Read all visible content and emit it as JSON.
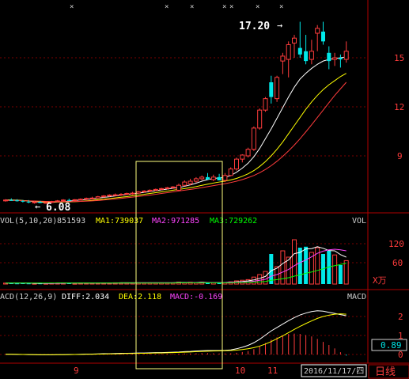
{
  "price_panel": {
    "y_ticks": [
      "15",
      "12",
      "9"
    ],
    "high_label": "17.20",
    "high_arrow": "→",
    "low_label": "6.08",
    "low_arrow": "←"
  },
  "volume_panel": {
    "title": "VOL(5,10,20)",
    "vol_value": "851593",
    "ma1_label": "MA1:739037",
    "ma2_label": "MA2:971285",
    "ma3_label": "MA3:729262",
    "right_label": "VOL",
    "y_ticks": [
      "120",
      "60"
    ],
    "unit_label": "X万"
  },
  "macd_panel": {
    "title": "MACD(12,26,9)",
    "diff_label": "DIFF:2.034",
    "dea_label": "DEA:2.118",
    "macd_label": "MACD:-0.169",
    "right_label": "MACD",
    "y_ticks": [
      "2",
      "1",
      "0"
    ],
    "value_box": "0.89"
  },
  "x_axis": {
    "labels": [
      "9",
      "10",
      "11"
    ],
    "date_box": "2016/11/17/四",
    "period_button": "日线"
  },
  "colors": {
    "up": "#ff3c3c",
    "down": "#00e8e8",
    "ma1": "#ffffff",
    "ma2": "#ffff00",
    "ma3": "#ff44ff",
    "ma4": "#00ff00",
    "grid": "#7a0000",
    "highlight_box": "#ffff80",
    "axis_text": "#ff3c3c"
  },
  "chart_data": [
    {
      "type": "candlestick",
      "title": "",
      "y_ticks": [
        9,
        12,
        15
      ],
      "ylim": [
        5,
        18
      ],
      "candles": [
        {
          "o": 6.25,
          "h": 6.35,
          "l": 6.2,
          "c": 6.3
        },
        {
          "o": 6.3,
          "h": 6.4,
          "l": 6.25,
          "c": 6.28
        },
        {
          "o": 6.28,
          "h": 6.35,
          "l": 6.2,
          "c": 6.25
        },
        {
          "o": 6.25,
          "h": 6.3,
          "l": 6.15,
          "c": 6.2
        },
        {
          "o": 6.2,
          "h": 6.3,
          "l": 6.1,
          "c": 6.15
        },
        {
          "o": 6.15,
          "h": 6.25,
          "l": 6.08,
          "c": 6.18
        },
        {
          "o": 6.18,
          "h": 6.25,
          "l": 6.1,
          "c": 6.12
        },
        {
          "o": 6.12,
          "h": 6.2,
          "l": 6.08,
          "c": 6.15
        },
        {
          "o": 6.15,
          "h": 6.25,
          "l": 6.1,
          "c": 6.2
        },
        {
          "o": 6.2,
          "h": 6.3,
          "l": 6.15,
          "c": 6.25
        },
        {
          "o": 6.25,
          "h": 6.35,
          "l": 6.2,
          "c": 6.3
        },
        {
          "o": 6.3,
          "h": 6.38,
          "l": 6.25,
          "c": 6.28
        },
        {
          "o": 6.28,
          "h": 6.35,
          "l": 6.2,
          "c": 6.32
        },
        {
          "o": 6.32,
          "h": 6.4,
          "l": 6.28,
          "c": 6.35
        },
        {
          "o": 6.35,
          "h": 6.45,
          "l": 6.3,
          "c": 6.4
        },
        {
          "o": 6.4,
          "h": 6.5,
          "l": 6.35,
          "c": 6.42
        },
        {
          "o": 6.42,
          "h": 6.55,
          "l": 6.38,
          "c": 6.5
        },
        {
          "o": 6.5,
          "h": 6.6,
          "l": 6.45,
          "c": 6.55
        },
        {
          "o": 6.55,
          "h": 6.65,
          "l": 6.5,
          "c": 6.6
        },
        {
          "o": 6.6,
          "h": 6.7,
          "l": 6.55,
          "c": 6.62
        },
        {
          "o": 6.62,
          "h": 6.72,
          "l": 6.55,
          "c": 6.65
        },
        {
          "o": 6.65,
          "h": 6.75,
          "l": 6.6,
          "c": 6.7
        },
        {
          "o": 6.7,
          "h": 6.8,
          "l": 6.62,
          "c": 6.72
        },
        {
          "o": 6.72,
          "h": 6.85,
          "l": 6.68,
          "c": 6.8
        },
        {
          "o": 6.8,
          "h": 6.9,
          "l": 6.75,
          "c": 6.85
        },
        {
          "o": 6.85,
          "h": 6.95,
          "l": 6.8,
          "c": 6.9
        },
        {
          "o": 6.9,
          "h": 7.0,
          "l": 6.85,
          "c": 6.95
        },
        {
          "o": 6.95,
          "h": 7.05,
          "l": 6.9,
          "c": 7.0
        },
        {
          "o": 7.0,
          "h": 7.1,
          "l": 6.95,
          "c": 7.05
        },
        {
          "o": 7.05,
          "h": 7.15,
          "l": 7.0,
          "c": 7.1
        },
        {
          "o": 6.9,
          "h": 7.3,
          "l": 6.85,
          "c": 7.2
        },
        {
          "o": 7.2,
          "h": 7.5,
          "l": 7.15,
          "c": 7.4
        },
        {
          "o": 7.3,
          "h": 7.6,
          "l": 7.2,
          "c": 7.45
        },
        {
          "o": 7.45,
          "h": 7.7,
          "l": 7.35,
          "c": 7.6
        },
        {
          "o": 7.6,
          "h": 7.8,
          "l": 7.5,
          "c": 7.7
        },
        {
          "o": 7.7,
          "h": 7.95,
          "l": 7.6,
          "c": 7.55
        },
        {
          "o": 7.55,
          "h": 7.85,
          "l": 7.45,
          "c": 7.7
        },
        {
          "o": 7.7,
          "h": 7.9,
          "l": 7.6,
          "c": 7.5
        },
        {
          "o": 7.5,
          "h": 7.95,
          "l": 7.4,
          "c": 7.8
        },
        {
          "o": 7.8,
          "h": 8.3,
          "l": 7.75,
          "c": 8.2
        },
        {
          "o": 8.2,
          "h": 8.9,
          "l": 8.1,
          "c": 8.8
        },
        {
          "o": 8.8,
          "h": 9.1,
          "l": 8.6,
          "c": 9.05
        },
        {
          "o": 9.0,
          "h": 9.5,
          "l": 8.9,
          "c": 9.4
        },
        {
          "o": 9.4,
          "h": 10.8,
          "l": 9.3,
          "c": 10.7
        },
        {
          "o": 10.7,
          "h": 11.9,
          "l": 10.6,
          "c": 11.8
        },
        {
          "o": 11.8,
          "h": 12.6,
          "l": 11.7,
          "c": 12.5
        },
        {
          "o": 13.5,
          "h": 13.9,
          "l": 12.2,
          "c": 12.6
        },
        {
          "o": 12.5,
          "h": 13.9,
          "l": 12.3,
          "c": 13.8
        },
        {
          "o": 14.8,
          "h": 15.3,
          "l": 14.0,
          "c": 15.1
        },
        {
          "o": 14.9,
          "h": 16.0,
          "l": 13.8,
          "c": 15.8
        },
        {
          "o": 15.9,
          "h": 16.4,
          "l": 15.0,
          "c": 16.2
        },
        {
          "o": 15.6,
          "h": 17.2,
          "l": 15.0,
          "c": 15.2
        },
        {
          "o": 15.4,
          "h": 16.4,
          "l": 14.6,
          "c": 14.8
        },
        {
          "o": 14.9,
          "h": 16.1,
          "l": 14.6,
          "c": 15.4
        },
        {
          "o": 16.5,
          "h": 17.0,
          "l": 15.4,
          "c": 16.8
        },
        {
          "o": 16.6,
          "h": 17.2,
          "l": 15.8,
          "c": 16.0
        },
        {
          "o": 15.3,
          "h": 15.7,
          "l": 14.3,
          "c": 14.8
        },
        {
          "o": 14.9,
          "h": 15.3,
          "l": 14.5,
          "c": 15.0
        },
        {
          "o": 15.0,
          "h": 15.2,
          "l": 14.4,
          "c": 14.9
        },
        {
          "o": 14.9,
          "h": 16.0,
          "l": 14.7,
          "c": 15.4
        }
      ],
      "ma_lines": [
        {
          "name": "MA1",
          "values": [
            6.3,
            6.3,
            6.29,
            6.27,
            6.24,
            6.2,
            6.18,
            6.16,
            6.16,
            6.18,
            6.2,
            6.23,
            6.27,
            6.3,
            6.33,
            6.37,
            6.42,
            6.46,
            6.5,
            6.55,
            6.6,
            6.64,
            6.68,
            6.72,
            6.77,
            6.82,
            6.87,
            6.92,
            6.97,
            7.02,
            7.06,
            7.14,
            7.23,
            7.33,
            7.45,
            7.55,
            7.62,
            7.65,
            7.68,
            7.8,
            8.0,
            8.25,
            8.55,
            8.95,
            9.45,
            10.05,
            10.65,
            11.3,
            11.95,
            12.6,
            13.2,
            13.7,
            14.05,
            14.35,
            14.6,
            14.8,
            14.9,
            14.95,
            15.0,
            15.05
          ]
        },
        {
          "name": "MA2",
          "values": [
            6.29,
            6.29,
            6.28,
            6.27,
            6.25,
            6.23,
            6.21,
            6.19,
            6.18,
            6.18,
            6.18,
            6.19,
            6.2,
            6.22,
            6.25,
            6.28,
            6.32,
            6.35,
            6.39,
            6.43,
            6.47,
            6.51,
            6.56,
            6.6,
            6.65,
            6.7,
            6.75,
            6.8,
            6.85,
            6.9,
            6.95,
            7.0,
            7.06,
            7.12,
            7.2,
            7.27,
            7.34,
            7.4,
            7.46,
            7.53,
            7.62,
            7.75,
            7.9,
            8.1,
            8.35,
            8.65,
            9.0,
            9.4,
            9.85,
            10.35,
            10.85,
            11.35,
            11.85,
            12.3,
            12.7,
            13.05,
            13.35,
            13.6,
            13.85,
            14.05
          ]
        },
        {
          "name": "MA3",
          "values": [
            6.27,
            6.27,
            6.27,
            6.26,
            6.25,
            6.24,
            6.23,
            6.22,
            6.21,
            6.2,
            6.2,
            6.2,
            6.21,
            6.22,
            6.23,
            6.25,
            6.27,
            6.3,
            6.33,
            6.36,
            6.4,
            6.44,
            6.48,
            6.52,
            6.56,
            6.6,
            6.65,
            6.7,
            6.75,
            6.8,
            6.85,
            6.9,
            6.95,
            7.0,
            7.06,
            7.12,
            7.18,
            7.24,
            7.3,
            7.37,
            7.45,
            7.55,
            7.67,
            7.8,
            7.97,
            8.17,
            8.4,
            8.67,
            8.97,
            9.3,
            9.66,
            10.05,
            10.47,
            10.9,
            11.35,
            11.8,
            12.25,
            12.7,
            13.1,
            13.5
          ]
        }
      ]
    },
    {
      "type": "bar",
      "title": "VOL(5,10,20)",
      "y_ticks": [
        60,
        120
      ],
      "ylim": [
        0,
        170
      ],
      "values": [
        3,
        3,
        2,
        3,
        2,
        2,
        2,
        2,
        3,
        3,
        3,
        3,
        2,
        3,
        3,
        3,
        3,
        3,
        3,
        4,
        4,
        4,
        4,
        4,
        4,
        4,
        4,
        4,
        4,
        4,
        6,
        5,
        6,
        5,
        6,
        5,
        5,
        6,
        5,
        7,
        10,
        12,
        14,
        22,
        30,
        40,
        95,
        55,
        105,
        85,
        140,
        115,
        118,
        100,
        115,
        95,
        105,
        92,
        60,
        74
      ],
      "up": [
        1,
        0,
        0,
        0,
        0,
        1,
        0,
        1,
        1,
        1,
        1,
        0,
        1,
        1,
        1,
        1,
        1,
        1,
        1,
        1,
        1,
        1,
        1,
        1,
        1,
        1,
        1,
        1,
        1,
        1,
        1,
        1,
        1,
        1,
        1,
        0,
        1,
        0,
        1,
        1,
        1,
        1,
        1,
        1,
        1,
        1,
        0,
        1,
        1,
        1,
        1,
        0,
        0,
        1,
        1,
        0,
        0,
        1,
        0,
        1
      ],
      "ma_lines": [
        {
          "name": "MA1",
          "values": [
            3,
            3,
            3,
            3,
            3,
            2,
            2,
            2,
            2,
            3,
            3,
            3,
            3,
            3,
            3,
            3,
            3,
            3,
            3,
            3,
            4,
            4,
            4,
            4,
            4,
            4,
            4,
            4,
            4,
            4,
            5,
            5,
            5,
            5,
            6,
            5,
            5,
            5,
            5,
            6,
            7,
            8,
            10,
            13,
            18,
            24,
            42,
            50,
            65,
            76,
            96,
            100,
            111,
            112,
            118,
            113,
            106,
            105,
            93,
            85
          ]
        },
        {
          "name": "MA2",
          "values": [
            3,
            3,
            3,
            3,
            3,
            3,
            3,
            2,
            2,
            2,
            2,
            3,
            3,
            3,
            3,
            3,
            3,
            3,
            3,
            3,
            3,
            3,
            3,
            4,
            4,
            4,
            4,
            4,
            4,
            4,
            4,
            4,
            5,
            5,
            5,
            5,
            5,
            5,
            5,
            6,
            6,
            7,
            7,
            9,
            12,
            15,
            25,
            30,
            38,
            46,
            58,
            68,
            76,
            86,
            97,
            104,
            108,
            110,
            108,
            105
          ]
        },
        {
          "name": "MA3",
          "values": [
            3,
            3,
            3,
            3,
            3,
            3,
            3,
            3,
            3,
            3,
            3,
            3,
            3,
            3,
            3,
            3,
            3,
            3,
            3,
            3,
            3,
            3,
            3,
            3,
            3,
            3,
            3,
            3,
            3,
            3,
            4,
            4,
            4,
            4,
            4,
            4,
            4,
            4,
            4,
            4,
            5,
            5,
            6,
            6,
            7,
            8,
            12,
            14,
            17,
            20,
            25,
            29,
            34,
            38,
            43,
            48,
            54,
            58,
            62,
            66
          ]
        }
      ]
    },
    {
      "type": "bar",
      "title": "MACD(12,26,9)",
      "y_ticks": [
        0,
        1,
        2
      ],
      "ylim": [
        -0.4,
        2.8
      ],
      "values": [
        0,
        0,
        0,
        0,
        -0.01,
        -0.01,
        -0.01,
        -0.01,
        -0.01,
        0,
        0,
        0,
        0.01,
        0.01,
        0.01,
        0.01,
        0.02,
        0.02,
        0.02,
        0.02,
        0.02,
        0.02,
        0.03,
        0.03,
        0.03,
        0.03,
        0.03,
        0.03,
        0.03,
        0.03,
        0.04,
        0.05,
        0.05,
        0.06,
        0.07,
        0.07,
        0.06,
        0.05,
        0.05,
        0.06,
        0.09,
        0.13,
        0.18,
        0.28,
        0.42,
        0.6,
        0.78,
        0.9,
        1.0,
        1.08,
        1.1,
        1.08,
        1.02,
        0.95,
        0.82,
        0.66,
        0.5,
        0.32,
        0.12,
        -0.06
      ],
      "diff": [
        0.01,
        0.01,
        0.0,
        0.0,
        -0.01,
        -0.01,
        -0.02,
        -0.02,
        -0.02,
        -0.01,
        -0.01,
        0.0,
        0.0,
        0.01,
        0.02,
        0.02,
        0.03,
        0.04,
        0.04,
        0.05,
        0.06,
        0.06,
        0.07,
        0.08,
        0.08,
        0.09,
        0.1,
        0.1,
        0.11,
        0.12,
        0.13,
        0.15,
        0.16,
        0.18,
        0.2,
        0.21,
        0.21,
        0.21,
        0.22,
        0.24,
        0.3,
        0.38,
        0.48,
        0.62,
        0.8,
        1.02,
        1.24,
        1.42,
        1.6,
        1.78,
        1.94,
        2.08,
        2.18,
        2.26,
        2.3,
        2.28,
        2.22,
        2.16,
        2.1,
        2.04
      ],
      "dea": [
        0.01,
        0.01,
        0.01,
        0.0,
        0.0,
        -0.01,
        -0.01,
        -0.01,
        -0.01,
        -0.01,
        -0.01,
        -0.01,
        0.0,
        0.0,
        0.01,
        0.01,
        0.02,
        0.02,
        0.03,
        0.03,
        0.04,
        0.05,
        0.05,
        0.06,
        0.06,
        0.07,
        0.08,
        0.08,
        0.09,
        0.1,
        0.11,
        0.12,
        0.13,
        0.15,
        0.16,
        0.17,
        0.18,
        0.19,
        0.2,
        0.21,
        0.23,
        0.26,
        0.3,
        0.36,
        0.44,
        0.55,
        0.68,
        0.83,
        0.98,
        1.15,
        1.32,
        1.48,
        1.63,
        1.77,
        1.9,
        2.0,
        2.07,
        2.12,
        2.14,
        2.12
      ]
    }
  ]
}
